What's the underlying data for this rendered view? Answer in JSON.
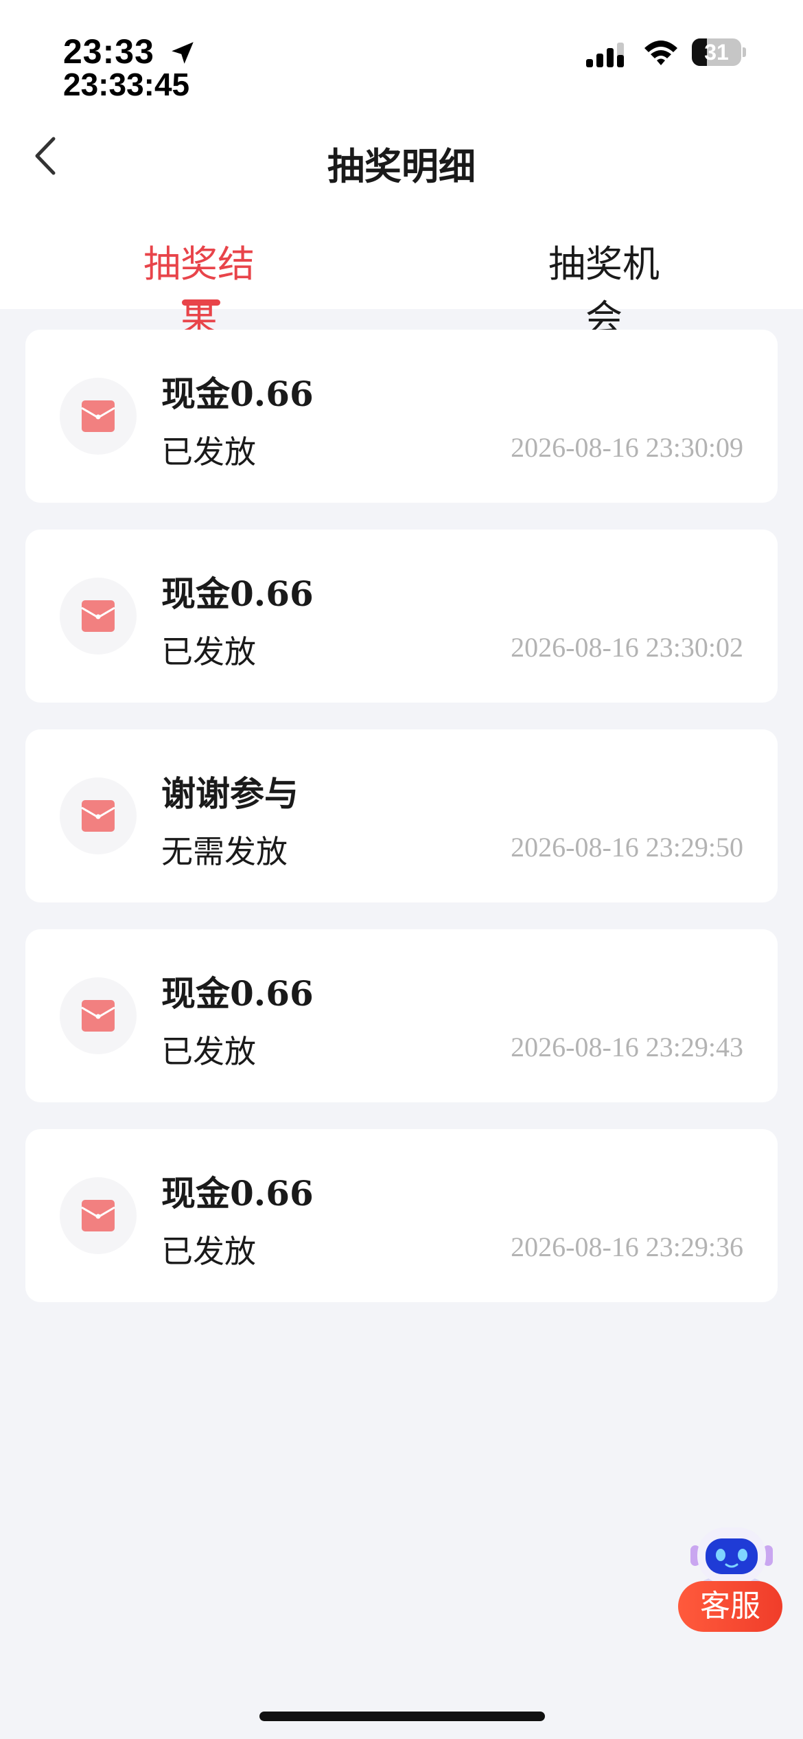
{
  "status_bar": {
    "time": "23:33",
    "time_seconds": "23:33:45",
    "battery_level": "31",
    "battery_fraction": 0.31
  },
  "header": {
    "title": "抽奖明细"
  },
  "tabs": [
    {
      "label": "抽奖结果",
      "active": true
    },
    {
      "label": "抽奖机会",
      "active": false
    }
  ],
  "records": [
    {
      "title": "现金0.66",
      "status": "已发放",
      "time": "2026-08-16 23:30:09"
    },
    {
      "title": "现金0.66",
      "status": "已发放",
      "time": "2026-08-16 23:30:02"
    },
    {
      "title": "谢谢参与",
      "status": "无需发放",
      "time": "2026-08-16 23:29:50"
    },
    {
      "title": "现金0.66",
      "status": "已发放",
      "time": "2026-08-16 23:29:43"
    },
    {
      "title": "现金0.66",
      "status": "已发放",
      "time": "2026-08-16 23:29:36"
    }
  ],
  "customer_service": {
    "label": "客服"
  },
  "colors": {
    "accent": "#e8444a",
    "envelope": "#f28080",
    "background": "#f3f4f8"
  },
  "icons": {
    "back": "chevron-left-icon",
    "envelope": "red-envelope-icon",
    "robot": "robot-icon"
  }
}
